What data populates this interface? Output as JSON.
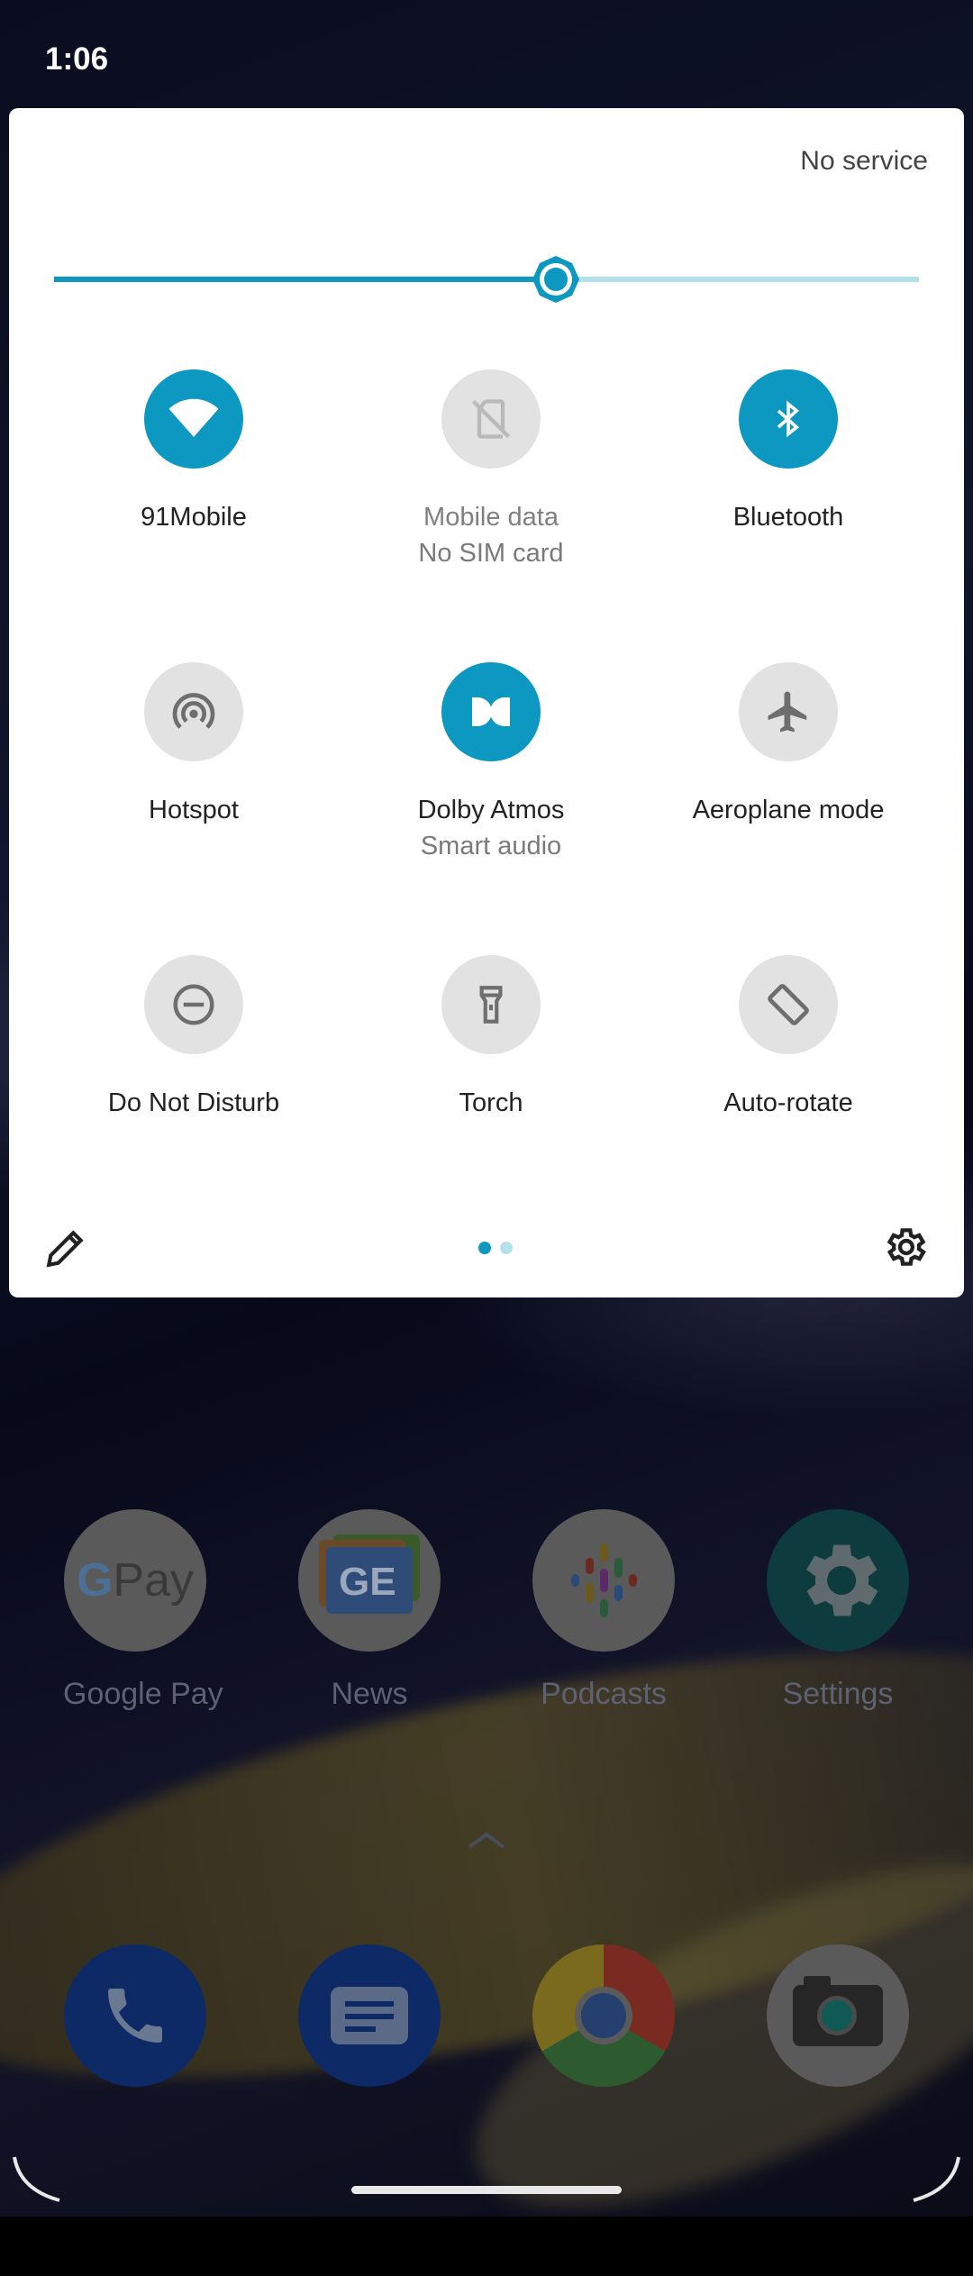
{
  "status_bar": {
    "time": "1:06"
  },
  "shade": {
    "carrier_status": "No service",
    "brightness": {
      "level": 0.58,
      "accent": "#0c98c0",
      "track": "#b5e1ec"
    },
    "tiles": [
      {
        "label": "91Mobile",
        "sub": "",
        "state": "on",
        "icon": "wifi-icon"
      },
      {
        "label": "Mobile data",
        "sub": "No SIM card",
        "state": "off",
        "icon": "no-sim-icon"
      },
      {
        "label": "Bluetooth",
        "sub": "",
        "state": "on",
        "icon": "bluetooth-icon"
      },
      {
        "label": "Hotspot",
        "sub": "",
        "state": "off",
        "icon": "hotspot-icon"
      },
      {
        "label": "Dolby Atmos",
        "sub": "Smart audio",
        "state": "on",
        "icon": "dolby-icon"
      },
      {
        "label": "Aeroplane mode",
        "sub": "",
        "state": "off",
        "icon": "airplane-icon"
      },
      {
        "label": "Do Not Disturb",
        "sub": "",
        "state": "off",
        "icon": "dnd-icon"
      },
      {
        "label": "Torch",
        "sub": "",
        "state": "off",
        "icon": "torch-icon"
      },
      {
        "label": "Auto-rotate",
        "sub": "",
        "state": "off",
        "icon": "auto-rotate-icon"
      }
    ],
    "page_indicator": {
      "pages": 2,
      "current": 1
    }
  },
  "home": {
    "apps": [
      {
        "label": "Google Pay",
        "icon": "google-pay-icon"
      },
      {
        "label": "News",
        "icon": "news-icon"
      },
      {
        "label": "Podcasts",
        "icon": "podcasts-icon"
      },
      {
        "label": "Settings",
        "icon": "settings-icon"
      }
    ],
    "dock": [
      {
        "icon": "phone-icon"
      },
      {
        "icon": "messages-icon"
      },
      {
        "icon": "chrome-icon"
      },
      {
        "icon": "camera-icon"
      }
    ],
    "gpay_text": "Pay",
    "news_text": "GE"
  }
}
